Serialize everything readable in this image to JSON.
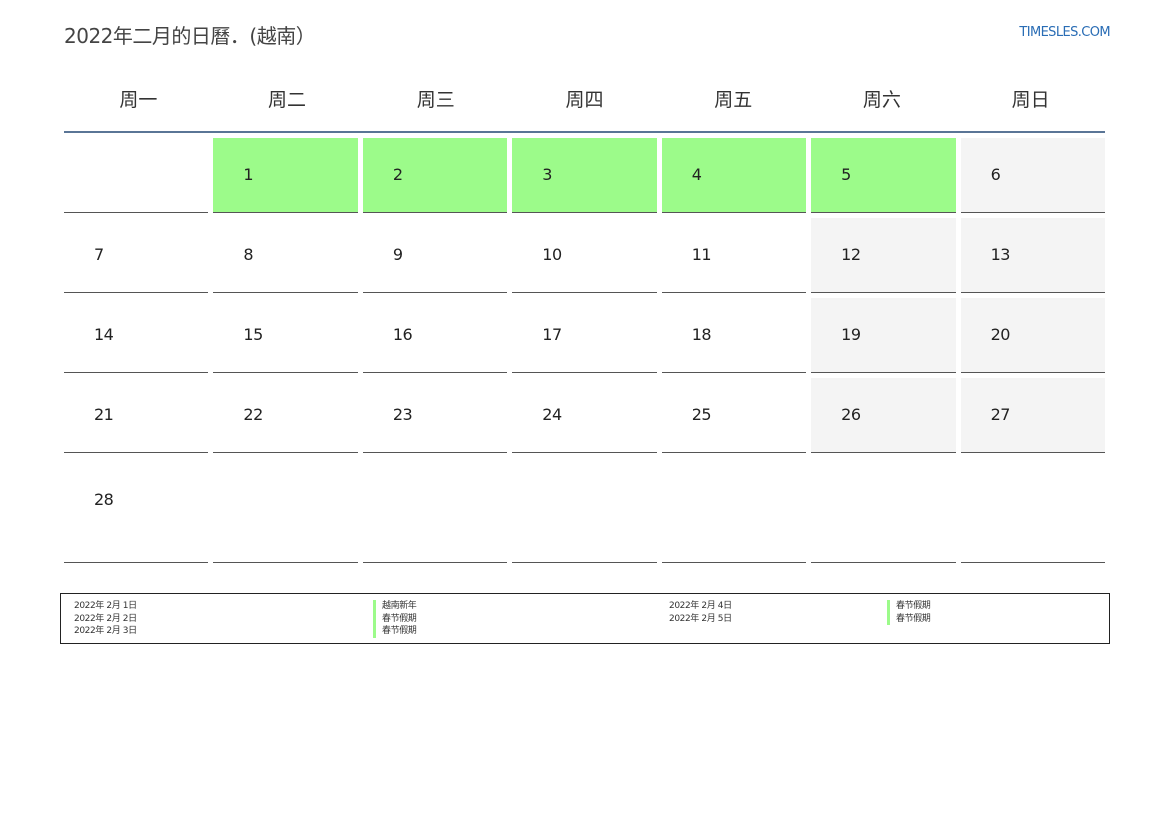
{
  "header": {
    "title": "2022年二月的日曆．(越南）",
    "site": "TIMESLES.COM"
  },
  "colors": {
    "holiday": "#9cfb8a",
    "weekend": "#f4f4f4",
    "header_rule": "#5a7596",
    "site_link": "#2a6db5"
  },
  "calendar": {
    "weekdays": [
      "周一",
      "周二",
      "周三",
      "周四",
      "周五",
      "周六",
      "周日"
    ],
    "weeks": [
      [
        "",
        "1",
        "2",
        "3",
        "4",
        "5",
        "6"
      ],
      [
        "7",
        "8",
        "9",
        "10",
        "11",
        "12",
        "13"
      ],
      [
        "14",
        "15",
        "16",
        "17",
        "18",
        "19",
        "20"
      ],
      [
        "21",
        "22",
        "23",
        "24",
        "25",
        "26",
        "27"
      ],
      [
        "28",
        "",
        "",
        "",
        "",
        "",
        ""
      ]
    ]
  },
  "legend": {
    "left": [
      {
        "date": "2022年 2月 1日",
        "name": "越南新年"
      },
      {
        "date": "2022年 2月 2日",
        "name": "春节假期"
      },
      {
        "date": "2022年 2月 3日",
        "name": "春节假期"
      }
    ],
    "right": [
      {
        "date": "2022年 2月 4日",
        "name": "春节假期"
      },
      {
        "date": "2022年 2月 5日",
        "name": "春节假期"
      }
    ]
  }
}
